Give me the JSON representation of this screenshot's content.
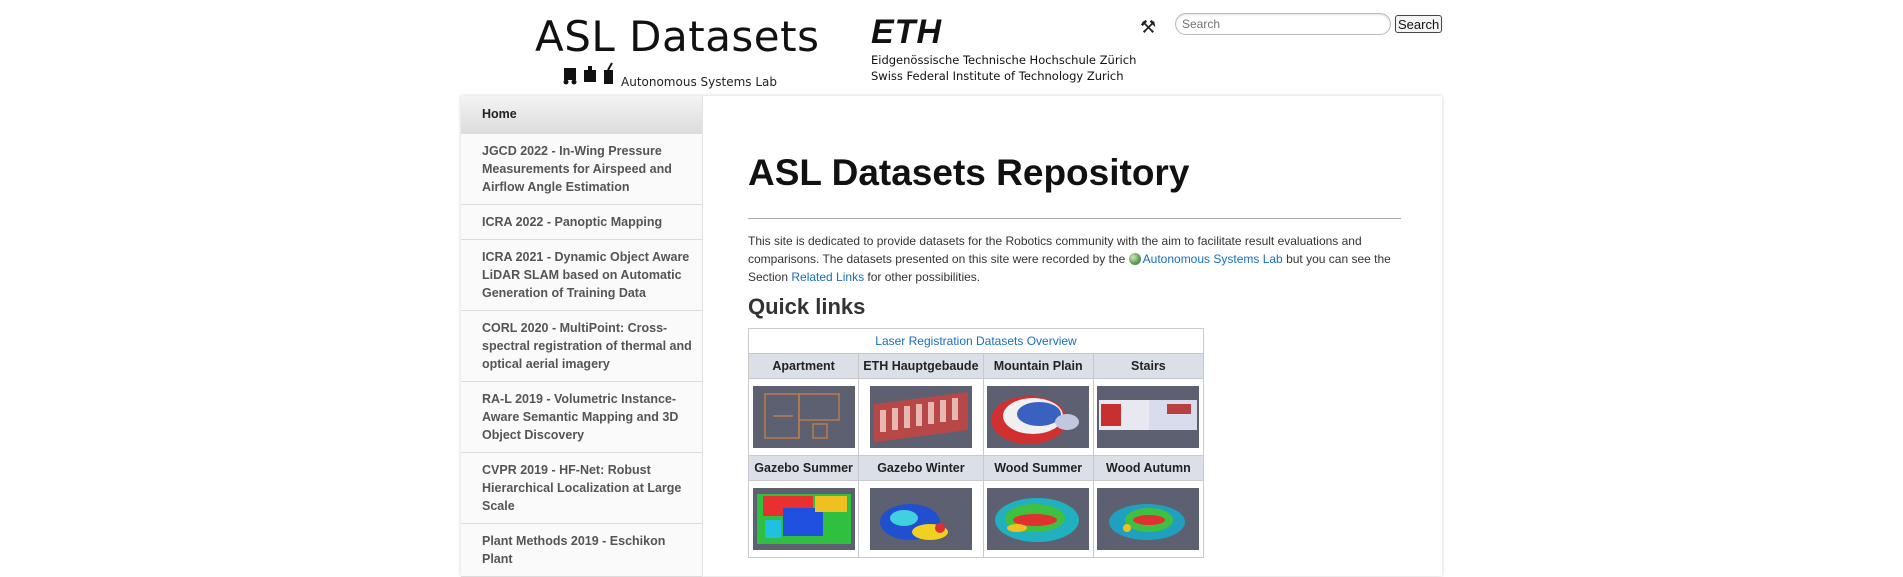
{
  "header": {
    "site_title": "ASL Datasets",
    "asl_lab": "Autonomous Systems Lab",
    "eth_logo": "ETH",
    "eth_line1": "Eidgenössische Technische Hochschule Zürich",
    "eth_line2": "Swiss Federal Institute of Technology Zurich",
    "search_placeholder": "Search",
    "search_button": "Search",
    "tools_icon": "tools-icon"
  },
  "sidebar": {
    "items": [
      {
        "label": "Home"
      },
      {
        "label": "JGCD 2022 - In-Wing Pressure Measurements for Airspeed and Airflow Angle Estimation"
      },
      {
        "label": "ICRA 2022 - Panoptic Mapping"
      },
      {
        "label": "ICRA 2021 - Dynamic Object Aware LiDAR SLAM based on Automatic Generation of Training Data"
      },
      {
        "label": "CORL 2020 - MultiPoint: Cross-spectral registration of thermal and optical aerial imagery"
      },
      {
        "label": "RA-L 2019 - Volumetric Instance-Aware Semantic Mapping and 3D Object Discovery"
      },
      {
        "label": "CVPR 2019 - HF-Net: Robust Hierarchical Localization at Large Scale"
      },
      {
        "label": "Plant Methods 2019 - Eschikon Plant"
      }
    ]
  },
  "main": {
    "title": "ASL Datasets Repository",
    "intro_part1": "This site is dedicated to provide datasets for the Robotics community with the aim to facilitate result evaluations and comparisons. The datasets presented on this site were recorded by the ",
    "intro_link1": "Autonomous Systems Lab",
    "intro_part2": " but you can see the Section ",
    "intro_link2": "Related Links",
    "intro_part3": " for other possibilities.",
    "quick_links_title": "Quick links",
    "table_caption": "Laser Registration Datasets Overview",
    "row1": [
      "Apartment",
      "ETH Hauptgebaude",
      "Mountain Plain",
      "Stairs"
    ],
    "row2": [
      "Gazebo Summer",
      "Gazebo Winter",
      "Wood Summer",
      "Wood Autumn"
    ]
  },
  "colors": {
    "link": "#1a6ec2",
    "table_header_bg": "#dbe0e8",
    "thumb_bg": "#5b6070"
  }
}
